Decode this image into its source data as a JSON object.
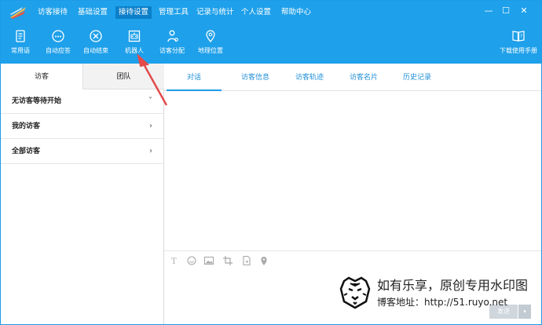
{
  "menubar": {
    "items": [
      "访客接待",
      "基础设置",
      "接待设置",
      "管理工具",
      "记录与统计",
      "个人设置",
      "帮助中心"
    ],
    "active_index": 2,
    "window_controls": [
      "—",
      "☐",
      "✕"
    ]
  },
  "toolbar": {
    "items": [
      {
        "label": "常用语",
        "icon": "document-icon"
      },
      {
        "label": "自动应答",
        "icon": "chat-bubble-icon"
      },
      {
        "label": "自动结束",
        "icon": "close-circle-icon"
      },
      {
        "label": "机器人",
        "icon": "robot-icon"
      },
      {
        "label": "访客分配",
        "icon": "distribute-icon"
      },
      {
        "label": "地理位置",
        "icon": "location-pin-icon"
      }
    ],
    "manual_label": "下载使用手册",
    "manual_icon": "manual-book-icon"
  },
  "left_tabs": [
    "访客",
    "团队"
  ],
  "visitor_groups": [
    {
      "label": "无访客等待开始",
      "chevron": "˅"
    },
    {
      "label": "我的访客",
      "chevron": "›"
    },
    {
      "label": "全部访客",
      "chevron": "›"
    }
  ],
  "right_tabs": [
    "对话",
    "访客信息",
    "访客轨迹",
    "访客名片",
    "历史记录"
  ],
  "editor_tools": [
    "font-icon",
    "emoji-icon",
    "image-icon",
    "crop-icon",
    "file-icon",
    "location-icon"
  ],
  "send_button": {
    "label": "发送",
    "dropdown": "▾"
  },
  "watermark": {
    "line1": "如有乐享，原创专用水印图",
    "line2": "博客地址：http://51.ruyo.net"
  },
  "colors": {
    "accent": "#1ea0ea",
    "arrow": "#e34b4b"
  }
}
